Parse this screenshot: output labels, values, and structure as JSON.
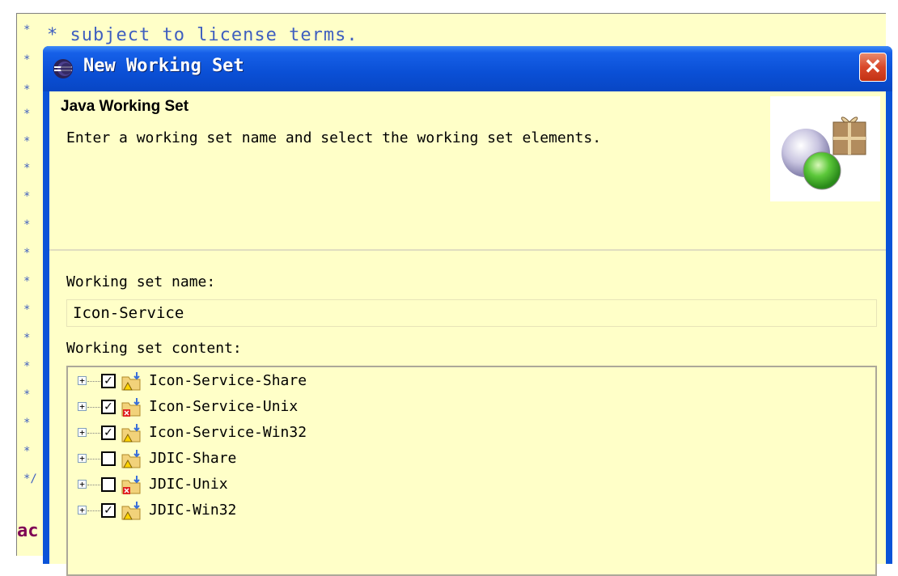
{
  "background_editor": {
    "code_line": "* subject to license terms.",
    "gutter_marks": [
      "*",
      "*",
      "*",
      "*",
      "*",
      "*",
      "*",
      "*",
      "*",
      "*",
      "*",
      "*",
      "*",
      "*",
      "*",
      "*",
      "*/"
    ],
    "bottom_code": "ac"
  },
  "dialog": {
    "title": "New Working Set",
    "close_label": "✕",
    "banner": {
      "title": "Java Working Set",
      "description": "Enter a working set name and select the working set elements."
    },
    "name_label": "Working set name:",
    "name_value": "Icon-Service",
    "content_label": "Working set content:",
    "items": [
      {
        "label": "Icon-Service-Share",
        "checked": true,
        "mark": "☑",
        "overlay": "warning-icon"
      },
      {
        "label": "Icon-Service-Unix",
        "checked": true,
        "mark": "☑",
        "overlay": "error-icon"
      },
      {
        "label": "Icon-Service-Win32",
        "checked": true,
        "mark": "☑",
        "overlay": "warning-icon"
      },
      {
        "label": "JDIC-Share",
        "checked": false,
        "mark": "",
        "overlay": "warning-icon"
      },
      {
        "label": "JDIC-Unix",
        "checked": false,
        "mark": "",
        "overlay": "error-icon"
      },
      {
        "label": "JDIC-Win32",
        "checked": true,
        "mark": "☑",
        "overlay": "warning-icon"
      }
    ],
    "expander_glyph": "+"
  },
  "colors": {
    "title_bar": "#0a4fd5",
    "client_bg": "#ffffc8",
    "close_red": "#d9482a"
  }
}
